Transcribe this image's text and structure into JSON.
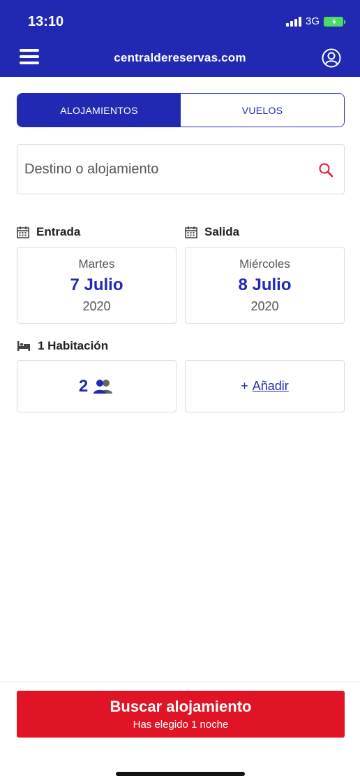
{
  "status_bar": {
    "time": "13:10",
    "network": "3G"
  },
  "header": {
    "site_title": "centraldereservas.com",
    "menu_icon": "hamburger-menu-icon",
    "user_icon": "user-account-icon",
    "background_color": "#2129b3"
  },
  "tabs": [
    {
      "label": "ALOJAMIENTOS",
      "active": true
    },
    {
      "label": "VUELOS",
      "active": false
    }
  ],
  "search": {
    "placeholder": "Destino o alojamiento",
    "value": "",
    "icon": "search-icon"
  },
  "dates": {
    "checkin": {
      "label": "Entrada",
      "weekday": "Martes",
      "day": "7 Julio",
      "year": "2020"
    },
    "checkout": {
      "label": "Salida",
      "weekday": "Miércoles",
      "day": "8 Julio",
      "year": "2020"
    }
  },
  "room": {
    "label": "1 Habitación",
    "guests": "2",
    "add_plus": "+",
    "add_label": "Añadir"
  },
  "cta": {
    "label": "Buscar alojamiento",
    "sublabel": "Has elegido 1 noche",
    "color": "#e11426"
  },
  "colors": {
    "primary": "#2129b3",
    "accent": "#e11426"
  }
}
